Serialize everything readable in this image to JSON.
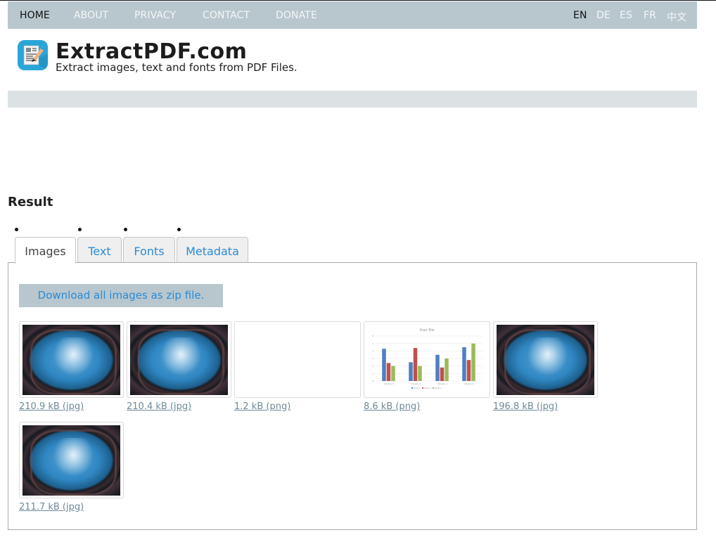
{
  "nav": {
    "items": [
      {
        "label": "HOME",
        "active": true
      },
      {
        "label": "ABOUT",
        "active": false
      },
      {
        "label": "PRIVACY",
        "active": false
      },
      {
        "label": "CONTACT",
        "active": false
      },
      {
        "label": "DONATE",
        "active": false
      }
    ],
    "languages": [
      {
        "label": "EN",
        "active": true
      },
      {
        "label": "DE",
        "active": false
      },
      {
        "label": "ES",
        "active": false
      },
      {
        "label": "FR",
        "active": false
      },
      {
        "label": "中文",
        "active": false
      }
    ]
  },
  "header": {
    "logo_icon": "pdf-document-edit-icon",
    "title": "ExtractPDF.com",
    "tagline": "Extract images, text and fonts from PDF Files."
  },
  "result": {
    "heading": "Result",
    "tabs": [
      {
        "label": "Images",
        "active": true
      },
      {
        "label": "Text",
        "active": false
      },
      {
        "label": "Fonts",
        "active": false
      },
      {
        "label": "Metadata",
        "active": false
      }
    ],
    "download_all_label": "Download all images as zip file.",
    "images": [
      {
        "kind": "photo",
        "caption": "210.9 kB (jpg)"
      },
      {
        "kind": "photo",
        "caption": "210.4 kB (jpg)"
      },
      {
        "kind": "blank",
        "caption": "1.2 kB (png)"
      },
      {
        "kind": "chart",
        "caption": "8.6 kB (png)"
      },
      {
        "kind": "photo",
        "caption": "196.8 kB (jpg)"
      },
      {
        "kind": "photo",
        "caption": "211.7 kB (jpg)"
      }
    ]
  },
  "chart_data": {
    "type": "bar",
    "title": "Chart Title",
    "categories": [
      "Category 1",
      "Category 2",
      "Category 3",
      "Category 4"
    ],
    "series": [
      {
        "name": "Series 1",
        "color": "#4f7fc0",
        "values": [
          4.3,
          2.5,
          3.5,
          4.5
        ]
      },
      {
        "name": "Series 2",
        "color": "#c0504d",
        "values": [
          2.4,
          4.4,
          1.8,
          2.8
        ]
      },
      {
        "name": "Series 3",
        "color": "#9bbb59",
        "values": [
          2.0,
          2.0,
          3.0,
          5.0
        ]
      }
    ],
    "ylim": [
      0,
      6
    ],
    "legend": "bottom",
    "grid": true
  },
  "colors": {
    "nav_bg": "#b8c7ce",
    "banner_bg": "#dce1e4",
    "link": "#2a8bd3",
    "caption": "#6f8a99"
  }
}
